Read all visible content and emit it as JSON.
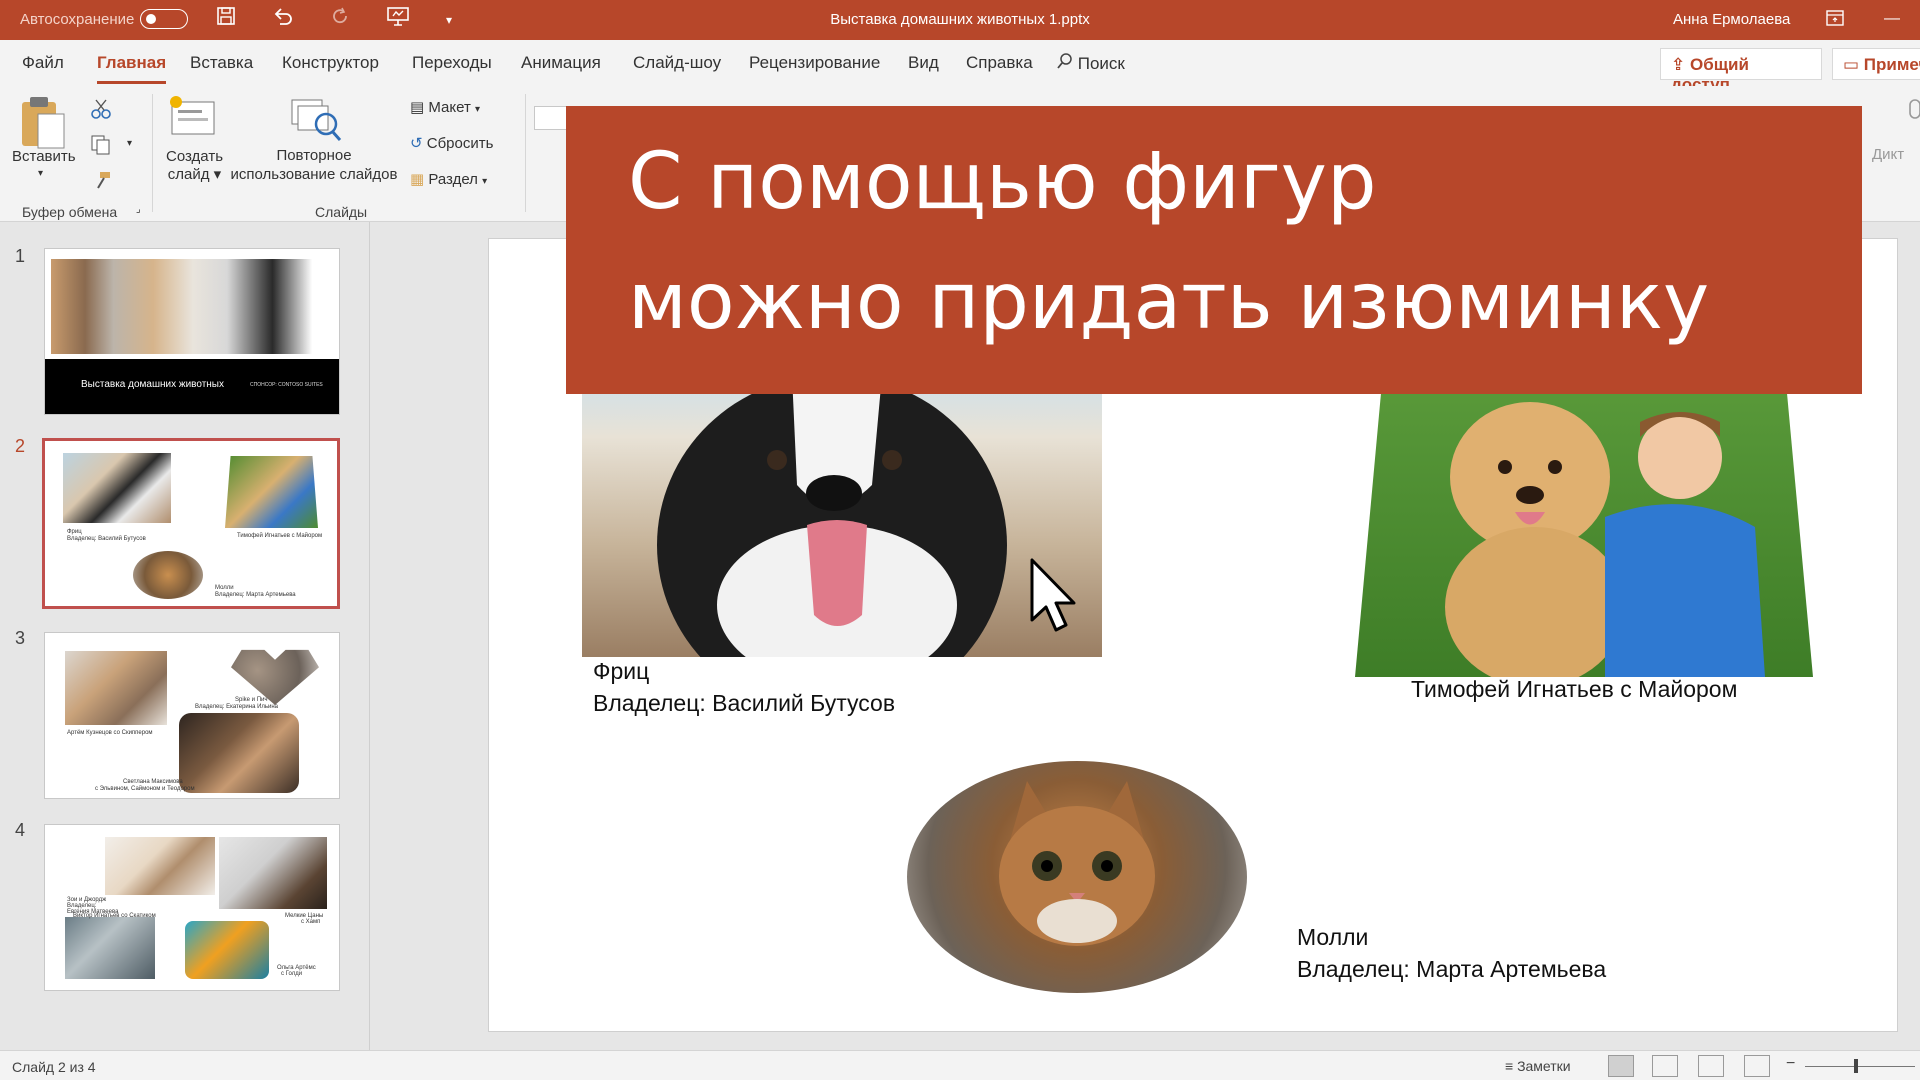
{
  "titlebar": {
    "autosave_label": "Автосохранение",
    "document_title": "Выставка домашних животных 1.pptx",
    "user_name": "Анна Ермолаева",
    "bg_color": "#b7472a"
  },
  "tabs": {
    "items": [
      "Файл",
      "Главная",
      "Вставка",
      "Конструктор",
      "Переходы",
      "Анимация",
      "Слайд-шоу",
      "Рецензирование",
      "Вид",
      "Справка"
    ],
    "active": "Главная",
    "search_label": "Поиск",
    "share_label": "Общий доступ",
    "comments_label": "Примеч"
  },
  "ribbon": {
    "paste_label": "Вставить",
    "clipboard_group": "Буфер обмена",
    "new_slide_label_1": "Создать",
    "new_slide_label_2": "слайд",
    "reuse_label_1": "Повторное",
    "reuse_label_2": "использование слайдов",
    "layout_label": "Макет",
    "reset_label": "Сбросить",
    "section_label": "Раздел",
    "slides_group": "Слайды",
    "dictate_label": "Дикт"
  },
  "thumbnails": {
    "numbers": [
      "1",
      "2",
      "3",
      "4"
    ],
    "selected": 2,
    "slide1_title": "Выставка домашних животных",
    "slide1_sponsor": "СПОНСОР: CONTOSO SUITES",
    "slide2_texts": [
      "Фриц",
      "Владелец: Василий Бутусов",
      "Тимофей Игнатьев с Майором",
      "Молли",
      "Владелец: Марта Артемьева"
    ],
    "slide3_texts": [
      "Артём Кузнецов со Скиппером",
      "Spike и Пич",
      "Владелец: Екатерина Ильина",
      "Светлана Максимова",
      "с Эльвином, Саймоном и Теодором"
    ],
    "slide4_texts": [
      "Зои и Джордж",
      "Владелец:",
      "Евгения Матвеева",
      "Виктор Игнатьев со Скатиком",
      "Мелкие Цаны",
      "с Хамп",
      "Ольга Артёмс",
      "с Голди"
    ]
  },
  "slide": {
    "caption1_line1": "Фриц",
    "caption1_line2": "Владелец: Василий Бутусов",
    "caption2": "Тимофей Игнатьев с Майором",
    "caption3_line1": "Молли",
    "caption3_line2": "Владелец: Марта Артемьева"
  },
  "banner": {
    "line1": "С помощью фигур",
    "line2": "можно придать изюминку",
    "color": "#b7472a"
  },
  "statusbar": {
    "slide_counter": "Слайд 2 из 4",
    "notes_label": "Заметки"
  }
}
